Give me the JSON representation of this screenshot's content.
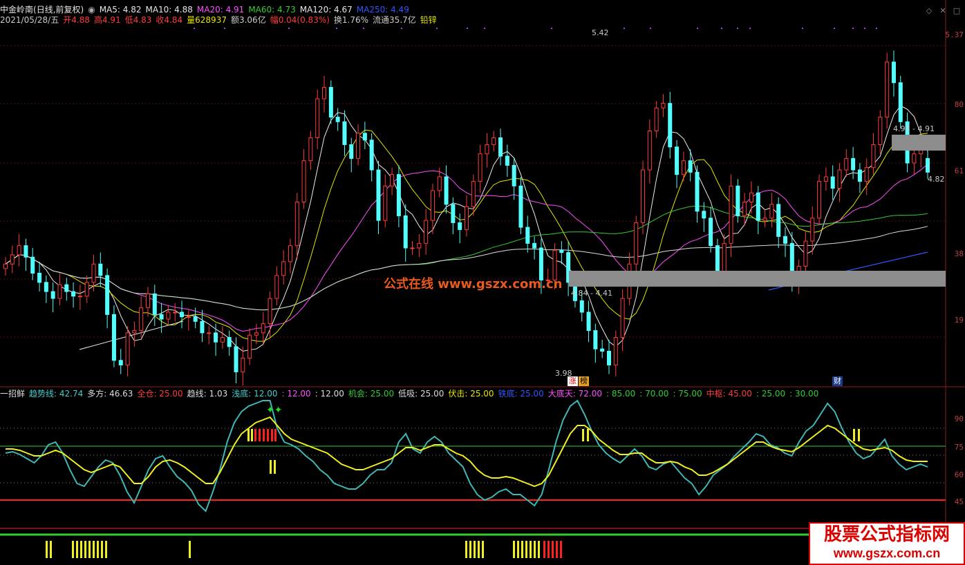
{
  "header": {
    "stock_name": "中金岭南",
    "period": "(日线,前复权)",
    "ma": [
      {
        "label": "MA5: 4.82",
        "color": "#e6e6e6"
      },
      {
        "label": "MA10: 4.88",
        "color": "#e6e6e6"
      },
      {
        "label": "MA20: 4.91",
        "color": "#ff4fff"
      },
      {
        "label": "MA60: 4.73",
        "color": "#33cc33"
      },
      {
        "label": "MA120: 4.67",
        "color": "#e6e6e6"
      },
      {
        "label": "MA250: 4.49",
        "color": "#3355ff"
      }
    ],
    "quote": [
      {
        "label": "2021/05/28/五",
        "color": "#cccccc"
      },
      {
        "label": "开4.88",
        "color": "#ff3b3b"
      },
      {
        "label": "高4.91",
        "color": "#ff3b3b"
      },
      {
        "label": "低4.83",
        "color": "#ff3b3b"
      },
      {
        "label": "收4.84",
        "color": "#ff3b3b"
      },
      {
        "label": "量628937",
        "color": "#e6e600"
      },
      {
        "label": "额3.06亿",
        "color": "#cccccc"
      },
      {
        "label": "幅0.04(0.83%)",
        "color": "#ff3b3b"
      },
      {
        "label": "换1.76%",
        "color": "#cccccc"
      },
      {
        "label": "流通35.7亿",
        "color": "#cccccc"
      },
      {
        "label": "铅锌",
        "color": "#e6e600"
      }
    ]
  },
  "price_axis": [
    "5.37",
    "80",
    "61",
    "38",
    "19"
  ],
  "price_notes": {
    "high": "5.42",
    "low": "3.98",
    "upper_zone": "4.98 - 4.91",
    "lower_zone": "4.84 - 4.41",
    "last": "4.82"
  },
  "tags": {
    "zhang": "涨",
    "bang": "榜",
    "cai": "财"
  },
  "watermark": "公式在线  www.gszx.com.cn",
  "logo": {
    "line1": "股票公式指标网",
    "line2": "www.gszx.com.cn"
  },
  "indicator_header": [
    {
      "label": "一招鲜",
      "color": "#dddddd"
    },
    {
      "label": "趋势线: 42.74",
      "color": "#44cccc"
    },
    {
      "label": "多方: 46.63",
      "color": "#dddddd"
    },
    {
      "label": "全仓: 25.00",
      "color": "#ff3b3b"
    },
    {
      "label": "趋线: 1.03",
      "color": "#dddddd"
    },
    {
      "label": "浅底: 12.00",
      "color": "#44cccc"
    },
    {
      "label": ": 12.00",
      "color": "#ff4fff"
    },
    {
      "label": ": 12.00",
      "color": "#dddddd"
    },
    {
      "label": "机会: 25.00",
      "color": "#33cc33"
    },
    {
      "label": "低吸: 25.00",
      "color": "#dddddd"
    },
    {
      "label": "伏击: 25.00",
      "color": "#e6e600"
    },
    {
      "label": "铁底: 25.00",
      "color": "#3355ff"
    },
    {
      "label": "大底天: 72.00",
      "color": "#ff4fff"
    },
    {
      "label": ": 85.00",
      "color": "#33cc33"
    },
    {
      "label": ": 70.00",
      "color": "#33cc33"
    },
    {
      "label": ": 75.00",
      "color": "#33cc33"
    },
    {
      "label": "中枢: 45.00",
      "color": "#ff3b3b"
    },
    {
      "label": ": 25.00",
      "color": "#33cc33"
    },
    {
      "label": ": 30.00",
      "color": "#33cc33"
    }
  ],
  "indicator_axis": [
    "90",
    "75",
    "60",
    "45"
  ],
  "chart_data": {
    "type": "candlestick",
    "price": {
      "close": [
        4.42,
        4.46,
        4.5,
        4.45,
        4.38,
        4.34,
        4.3,
        4.27,
        4.33,
        4.3,
        4.28,
        4.28,
        4.34,
        4.42,
        4.37,
        4.2,
        4.0,
        3.98,
        4.12,
        4.13,
        4.23,
        4.29,
        4.2,
        4.18,
        4.21,
        4.21,
        4.19,
        4.19,
        4.17,
        4.12,
        4.12,
        4.08,
        4.1,
        4.06,
        3.95,
        4.01,
        4.11,
        4.12,
        4.16,
        4.27,
        4.37,
        4.43,
        4.5,
        4.69,
        4.87,
        4.97,
        5.14,
        5.19,
        5.06,
        5.04,
        4.94,
        4.88,
        4.99,
        4.96,
        4.83,
        4.61,
        4.76,
        4.81,
        4.63,
        4.49,
        4.49,
        4.51,
        4.61,
        4.74,
        4.8,
        4.68,
        4.6,
        4.57,
        4.67,
        4.78,
        4.9,
        4.94,
        4.97,
        4.89,
        4.85,
        4.76,
        4.58,
        4.51,
        4.49,
        4.35,
        4.35,
        4.48,
        4.47,
        4.34,
        4.26,
        4.21,
        4.13,
        4.05,
        4.04,
        3.98,
        4.1,
        4.27,
        4.42,
        4.6,
        4.83,
        5.0,
        5.1,
        5.12,
        4.93,
        4.81,
        4.87,
        4.82,
        4.65,
        4.62,
        4.5,
        4.37,
        4.51,
        4.76,
        4.63,
        4.69,
        4.73,
        4.61,
        4.62,
        4.68,
        4.54,
        4.51,
        4.33,
        4.41,
        4.52,
        4.62,
        4.78,
        4.8,
        4.75,
        4.83,
        4.88,
        4.83,
        4.78,
        4.84,
        4.94,
        5.06,
        5.3,
        5.21,
        5.04,
        4.86,
        4.9,
        4.93,
        4.82
      ],
      "open": [
        4.4,
        4.42,
        4.46,
        4.5,
        4.45,
        4.38,
        4.34,
        4.3,
        4.27,
        4.33,
        4.3,
        4.28,
        4.28,
        4.34,
        4.42,
        4.37,
        4.2,
        4.0,
        3.98,
        4.12,
        4.13,
        4.23,
        4.29,
        4.2,
        4.18,
        4.21,
        4.21,
        4.19,
        4.19,
        4.17,
        4.12,
        4.12,
        4.08,
        4.1,
        4.06,
        3.95,
        4.01,
        4.11,
        4.12,
        4.16,
        4.27,
        4.37,
        4.43,
        4.5,
        4.69,
        4.87,
        4.97,
        5.14,
        5.19,
        5.06,
        5.04,
        4.94,
        4.88,
        4.99,
        4.96,
        4.83,
        4.61,
        4.76,
        4.81,
        4.63,
        4.49,
        4.49,
        4.51,
        4.61,
        4.74,
        4.8,
        4.68,
        4.6,
        4.57,
        4.67,
        4.78,
        4.9,
        4.94,
        4.97,
        4.89,
        4.85,
        4.76,
        4.58,
        4.51,
        4.49,
        4.35,
        4.35,
        4.48,
        4.47,
        4.34,
        4.26,
        4.21,
        4.13,
        4.05,
        4.04,
        3.98,
        4.1,
        4.27,
        4.42,
        4.6,
        4.83,
        5.0,
        5.1,
        5.12,
        4.93,
        4.81,
        4.87,
        4.82,
        4.65,
        4.62,
        4.5,
        4.37,
        4.51,
        4.76,
        4.63,
        4.69,
        4.73,
        4.61,
        4.62,
        4.68,
        4.54,
        4.51,
        4.33,
        4.41,
        4.52,
        4.62,
        4.78,
        4.8,
        4.75,
        4.83,
        4.88,
        4.83,
        4.78,
        4.84,
        4.94,
        5.06,
        5.3,
        5.21,
        5.04,
        4.86,
        4.9,
        4.88
      ],
      "ylim": [
        3.9,
        5.45
      ]
    },
    "indicator": {
      "trend": [
        52,
        53,
        51,
        48,
        45,
        50,
        58,
        60,
        52,
        40,
        30,
        28,
        35,
        42,
        47,
        45,
        36,
        24,
        16,
        28,
        40,
        48,
        50,
        42,
        35,
        31,
        25,
        15,
        10,
        24,
        40,
        60,
        74,
        82,
        86,
        88,
        90,
        90,
        70,
        60,
        58,
        55,
        50,
        46,
        40,
        36,
        30,
        28,
        26,
        26,
        30,
        36,
        40,
        40,
        45,
        60,
        66,
        55,
        52,
        60,
        64,
        60,
        52,
        47,
        42,
        30,
        22,
        18,
        20,
        24,
        26,
        22,
        22,
        18,
        14,
        22,
        40,
        60,
        76,
        86,
        90,
        80,
        68,
        58,
        52,
        48,
        45,
        50,
        55,
        50,
        42,
        40,
        44,
        46,
        40,
        34,
        30,
        22,
        28,
        36,
        40,
        44,
        50,
        55,
        60,
        66,
        64,
        58,
        56,
        52,
        50,
        60,
        68,
        72,
        80,
        88,
        82,
        70,
        60,
        52,
        48,
        50,
        56,
        62,
        50,
        44,
        40,
        42,
        44,
        42
      ],
      "bull": [
        55,
        55,
        54,
        52,
        50,
        50,
        52,
        54,
        52,
        48,
        44,
        40,
        38,
        40,
        42,
        44,
        42,
        36,
        30,
        30,
        35,
        42,
        46,
        47,
        45,
        42,
        38,
        34,
        30,
        30,
        38,
        48,
        58,
        66,
        70,
        74,
        76,
        78,
        72,
        66,
        62,
        60,
        58,
        56,
        54,
        52,
        48,
        44,
        42,
        40,
        40,
        42,
        44,
        46,
        48,
        52,
        56,
        56,
        54,
        56,
        58,
        58,
        55,
        52,
        50,
        46,
        40,
        36,
        34,
        34,
        35,
        34,
        32,
        30,
        28,
        30,
        36,
        46,
        56,
        66,
        72,
        72,
        68,
        62,
        58,
        54,
        51,
        51,
        52,
        52,
        48,
        45,
        45,
        46,
        45,
        42,
        40,
        36,
        36,
        38,
        41,
        44,
        48,
        52,
        56,
        60,
        60,
        57,
        55,
        54,
        53,
        56,
        60,
        64,
        68,
        72,
        70,
        66,
        62,
        58,
        55,
        54,
        55,
        56,
        54,
        50,
        47,
        46,
        46,
        46
      ]
    }
  }
}
